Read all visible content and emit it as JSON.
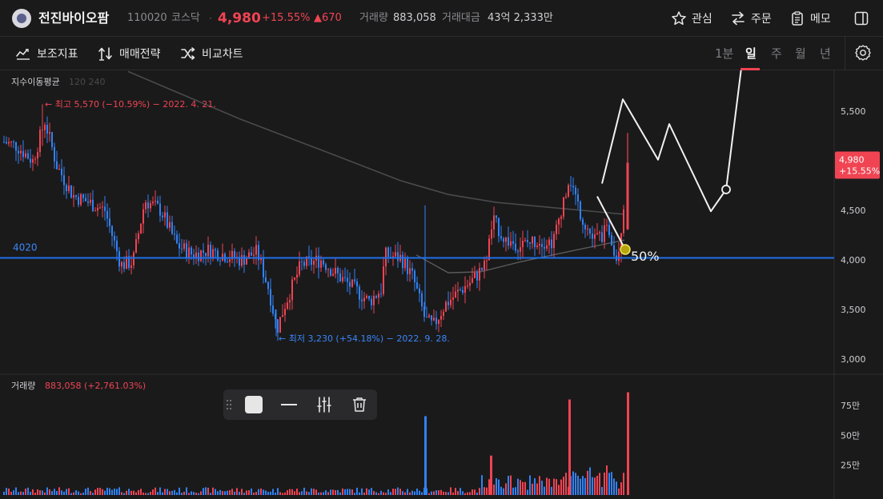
{
  "header": {
    "stock_name": "전진바이오팜",
    "stock_code": "110020",
    "market": "코스닥",
    "separator": "·",
    "price": "4,980",
    "change_rate": "+15.55%",
    "change_amount": "▲670",
    "volume_label": "거래량",
    "volume_value": "883,058",
    "trade_amount_label": "거래대금",
    "trade_amount_value": "43억 2,333만",
    "favorite_label": "관심",
    "order_label": "주문",
    "memo_label": "메모"
  },
  "toolbar": {
    "indicator_label": "보조지표",
    "strategy_label": "매매전략",
    "compare_label": "비교차트",
    "periods": [
      "1분",
      "일",
      "주",
      "월",
      "년"
    ],
    "active_period": "일"
  },
  "chart_data": [
    {
      "type": "candlestick",
      "overlay_label": "지수이동평균",
      "overlay_periods": "120 240",
      "y_ticks": [
        "5,500",
        "5,000",
        "4,500",
        "4,000",
        "3,500",
        "3,000"
      ],
      "ylim": [
        2900,
        5900
      ],
      "last_price": 4980,
      "last_price_label": "4,980",
      "last_change_label": "+15.55%",
      "horizontal_line": {
        "value": 4020,
        "label": "4020"
      },
      "high_annotation": "← 최고 5,570 (−10.59%) − 2022. 4. 21.",
      "low_annotation": "← 최저 3,230 (+54.18%) − 2022. 9. 28.",
      "drawing_label": "50%",
      "colors": {
        "up": "#f04452",
        "down": "#3182f6",
        "line": "#1e6fe8",
        "drawing": "#f2f2f2"
      }
    },
    {
      "type": "bar",
      "title": "거래량",
      "value_label": "883,058 (+2,761.03%)",
      "y_ticks": [
        "75만",
        "50만",
        "25만"
      ],
      "ylim": [
        0,
        900000
      ]
    }
  ],
  "icons": {
    "favorite": "star-icon",
    "order": "swap-icon",
    "memo": "clipboard-icon",
    "panel": "panel-icon",
    "indicator": "indicator-icon",
    "strategy": "strategy-icon",
    "compare": "shuffle-icon",
    "settings": "gear-icon",
    "drag": "drag-handle-icon",
    "fill": "fill-color-icon",
    "line_style": "line-style-icon",
    "adjust": "sliders-icon",
    "delete": "trash-icon"
  }
}
